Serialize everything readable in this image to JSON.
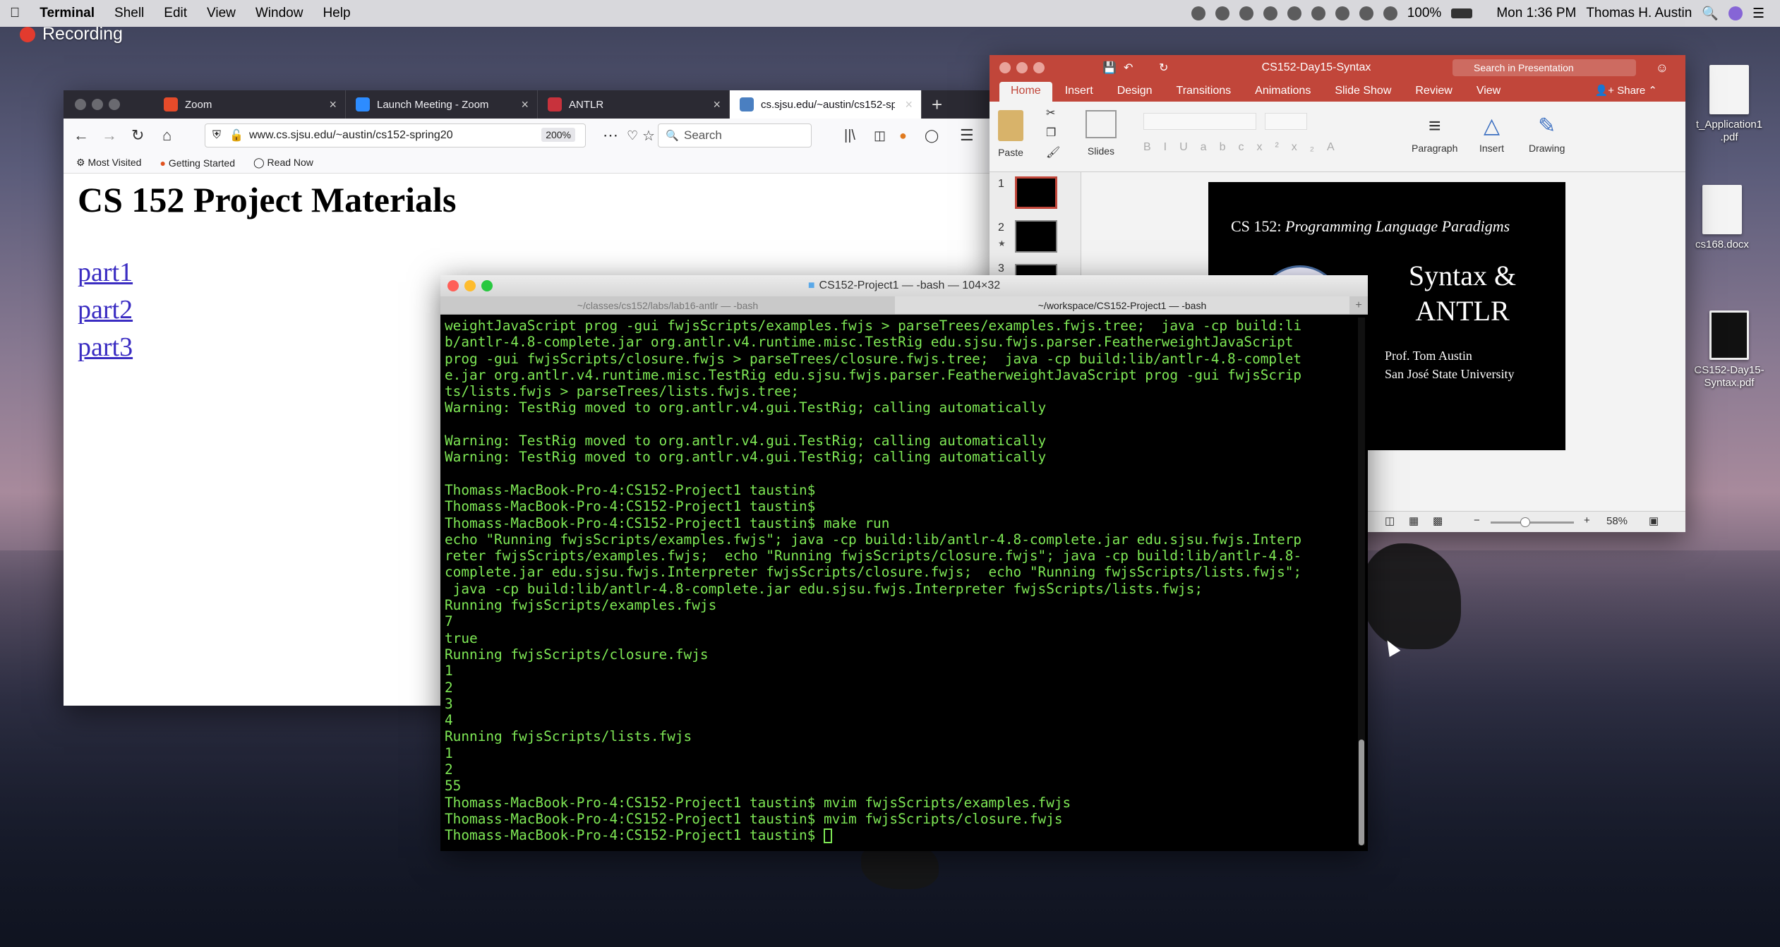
{
  "menubar": {
    "app": "Terminal",
    "menus": [
      "Shell",
      "Edit",
      "View",
      "Window",
      "Help"
    ],
    "battery": "100%",
    "clock": "Mon 1:36 PM",
    "user": "Thomas H. Austin"
  },
  "recording": "Recording",
  "firefox": {
    "tabs": [
      {
        "label": "Zoom",
        "fav": "#e54b2a"
      },
      {
        "label": "Launch Meeting - Zoom",
        "fav": "#2d8cff"
      },
      {
        "label": "ANTLR",
        "fav": "#c8323c"
      },
      {
        "label": "cs.sjsu.edu/~austin/cs152-spri",
        "fav": "#4a7fc1"
      }
    ],
    "url": "www.cs.sjsu.edu/~austin/cs152-spring20",
    "zoom": "200%",
    "search_placeholder": "Search",
    "bookmarks": [
      "Most Visited",
      "Getting Started",
      "Read Now"
    ],
    "page": {
      "title": "CS 152 Project Materials",
      "links": [
        "part1",
        "part2",
        "part3"
      ]
    }
  },
  "powerpoint": {
    "title": "CS152-Day15-Syntax",
    "search": "Search in Presentation",
    "share": "Share",
    "tabs": [
      "Home",
      "Insert",
      "Design",
      "Transitions",
      "Animations",
      "Slide Show",
      "Review",
      "View"
    ],
    "ribbon": {
      "paste": "Paste",
      "slides": "Slides",
      "paragraph": "Paragraph",
      "insert": "Insert",
      "drawing": "Drawing"
    },
    "thumb_numbers": [
      "1",
      "2",
      "3"
    ],
    "slide": {
      "course": "CS 152: ",
      "course_italic": "Programming Language Paradigms",
      "heading1": "Syntax &",
      "heading2": "ANTLR",
      "author": "Prof. Tom Austin",
      "school": "San José State University"
    },
    "zoom": "58%"
  },
  "terminal": {
    "title": "CS152-Project1 — -bash — 104×32",
    "tabs": [
      "~/classes/cs152/labs/lab16-antlr — -bash",
      "~/workspace/CS152-Project1 — -bash"
    ],
    "lines": [
      "weightJavaScript prog -gui fwjsScripts/examples.fwjs > parseTrees/examples.fwjs.tree;  java -cp build:li",
      "b/antlr-4.8-complete.jar org.antlr.v4.runtime.misc.TestRig edu.sjsu.fwjs.parser.FeatherweightJavaScript",
      "prog -gui fwjsScripts/closure.fwjs > parseTrees/closure.fwjs.tree;  java -cp build:lib/antlr-4.8-complet",
      "e.jar org.antlr.v4.runtime.misc.TestRig edu.sjsu.fwjs.parser.FeatherweightJavaScript prog -gui fwjsScrip",
      "ts/lists.fwjs > parseTrees/lists.fwjs.tree;",
      "Warning: TestRig moved to org.antlr.v4.gui.TestRig; calling automatically",
      "",
      "Warning: TestRig moved to org.antlr.v4.gui.TestRig; calling automatically",
      "Warning: TestRig moved to org.antlr.v4.gui.TestRig; calling automatically",
      "",
      "Thomass-MacBook-Pro-4:CS152-Project1 taustin$",
      "Thomass-MacBook-Pro-4:CS152-Project1 taustin$",
      "Thomass-MacBook-Pro-4:CS152-Project1 taustin$ make run",
      "echo \"Running fwjsScripts/examples.fwjs\"; java -cp build:lib/antlr-4.8-complete.jar edu.sjsu.fwjs.Interp",
      "reter fwjsScripts/examples.fwjs;  echo \"Running fwjsScripts/closure.fwjs\"; java -cp build:lib/antlr-4.8-",
      "complete.jar edu.sjsu.fwjs.Interpreter fwjsScripts/closure.fwjs;  echo \"Running fwjsScripts/lists.fwjs\";",
      " java -cp build:lib/antlr-4.8-complete.jar edu.sjsu.fwjs.Interpreter fwjsScripts/lists.fwjs;",
      "Running fwjsScripts/examples.fwjs",
      "7",
      "true",
      "Running fwjsScripts/closure.fwjs",
      "1",
      "2",
      "3",
      "4",
      "Running fwjsScripts/lists.fwjs",
      "1",
      "2",
      "55",
      "Thomass-MacBook-Pro-4:CS152-Project1 taustin$ mvim fwjsScripts/examples.fwjs",
      "Thomass-MacBook-Pro-4:CS152-Project1 taustin$ mvim fwjsScripts/closure.fwjs"
    ],
    "prompt": "Thomass-MacBook-Pro-4:CS152-Project1 taustin$ "
  },
  "desktop": {
    "icons": [
      {
        "label": "t_Application1\n.pdf"
      },
      {
        "label": "cs168.docx"
      },
      {
        "label": "CS152-Day15-\nSyntax.pdf"
      }
    ]
  }
}
